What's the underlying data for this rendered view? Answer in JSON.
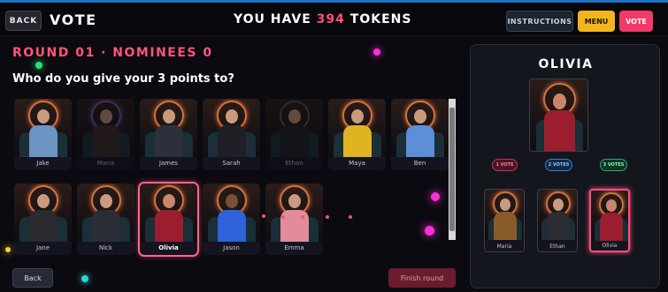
{
  "header": {
    "back_label": "BACK",
    "title": "VOTE",
    "tokens_prefix": "YOU HAVE",
    "tokens_value": "394",
    "tokens_suffix": "TOKENS",
    "instructions_label": "INSTRUCTIONS",
    "menu_label": "MENU",
    "vote_label": "VOTE"
  },
  "round": {
    "title": "ROUND 01 · NOMINEES 0",
    "question": "Who do you give your 3 points to?"
  },
  "nominees": [
    {
      "name": "Jake"
    },
    {
      "name": "Maria"
    },
    {
      "name": "James"
    },
    {
      "name": "Sarah"
    },
    {
      "name": "Ethan"
    },
    {
      "name": "Maya"
    },
    {
      "name": "Ben"
    },
    {
      "name": "Jane"
    },
    {
      "name": "Nick"
    },
    {
      "name": "Olivia"
    },
    {
      "name": "Jason"
    },
    {
      "name": "Emma"
    }
  ],
  "footer": {
    "back_label": "Back",
    "finish_label": "Finish round"
  },
  "panel": {
    "selected_name": "OLIVIA",
    "vote1_label": "1 VOTE",
    "vote2_label": "2 VOTES",
    "vote3_label": "3 VOTES",
    "slots": [
      {
        "name": "Maria"
      },
      {
        "name": "Ethan"
      },
      {
        "name": "Olivia"
      }
    ]
  },
  "colors": {
    "accent_pink": "#ff4f7d",
    "menu_yellow": "#f3b51e",
    "vote_red": "#f03a68"
  }
}
